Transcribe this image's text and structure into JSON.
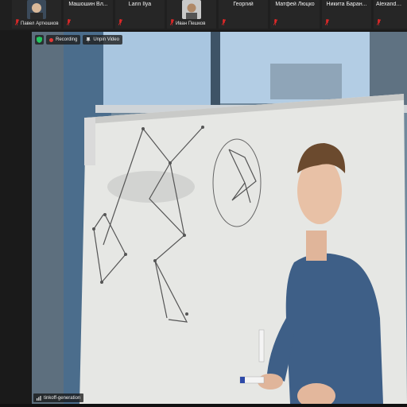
{
  "participants": [
    {
      "name": "Павел Артюшков",
      "has_video": true
    },
    {
      "name": "Машошин Вл...",
      "has_video": false
    },
    {
      "name": "Larin Ilya",
      "has_video": false
    },
    {
      "name": "Иван Пешков",
      "has_video": true
    },
    {
      "name": "Георгий",
      "has_video": false
    },
    {
      "name": "Матфей Люцко",
      "has_video": false
    },
    {
      "name": "Никита Баран...",
      "has_video": false
    },
    {
      "name": "Alexander R...",
      "has_video": false
    }
  ],
  "active_speaker": {
    "name_label": "tinkoff-generation"
  },
  "indicators": {
    "recording_label": "Recording",
    "unpin_label": "Unpin Video"
  },
  "colors": {
    "muted_mic": "#e02828",
    "recording": "#e53935",
    "shield": "#22c55e"
  }
}
